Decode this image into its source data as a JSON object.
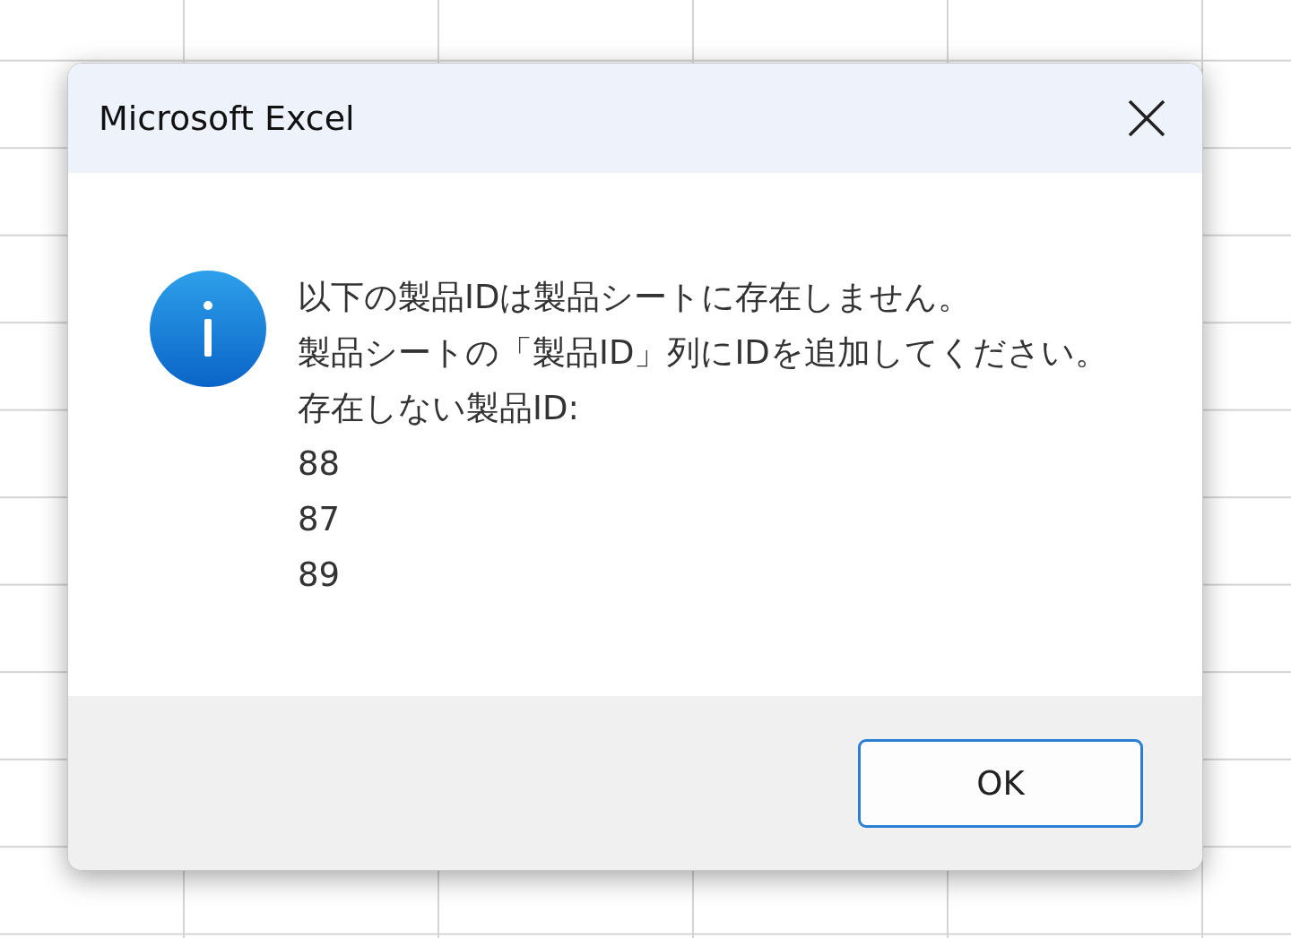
{
  "window": {
    "title": "Microsoft Excel"
  },
  "message": {
    "lines": [
      "以下の製品IDは製品シートに存在しません。",
      "製品シートの「製品ID」列にIDを追加してください。",
      "存在しない製品ID:",
      "88",
      "87",
      "89"
    ]
  },
  "buttons": [
    {
      "label": "OK",
      "selected": true
    }
  ]
}
